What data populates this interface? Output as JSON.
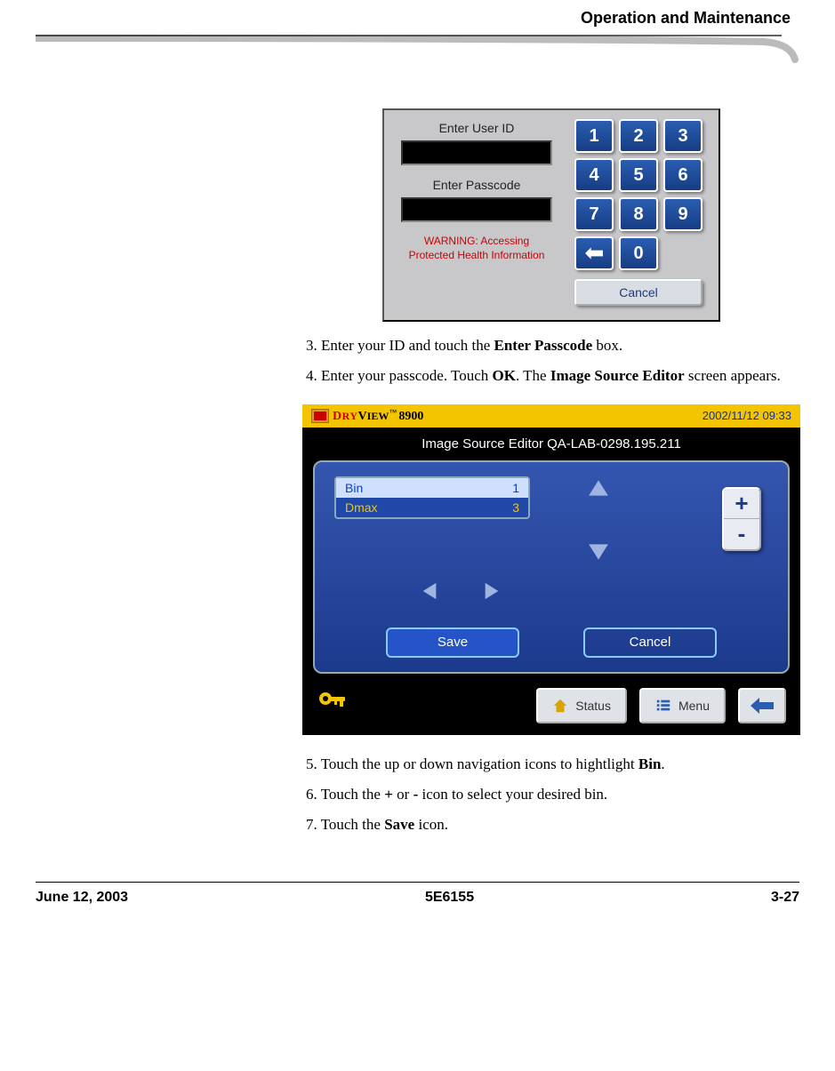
{
  "header": {
    "section_title": "Operation and Maintenance"
  },
  "screenshot1": {
    "label_user": "Enter User ID",
    "label_pass": "Enter Passcode",
    "warning_l1": "WARNING: Accessing",
    "warning_l2": "Protected Health Information",
    "keys": [
      "1",
      "2",
      "3",
      "4",
      "5",
      "6",
      "7",
      "8",
      "9"
    ],
    "zero": "0",
    "cancel": "Cancel"
  },
  "instructions_a": [
    {
      "n": "3.",
      "pre": "Enter your ID and touch the ",
      "b1": "Enter Passcode",
      "post": " box."
    },
    {
      "n": "4.",
      "pre": "Enter your passcode. Touch ",
      "b1": "OK",
      "mid": ". The ",
      "b2": "Image Source Editor",
      "post": " screen appears."
    }
  ],
  "screenshot2": {
    "brand_dry": "D",
    "brand_ry": "RY",
    "brand_v": "V",
    "brand_iew": "IEW",
    "brand_tm": "™",
    "brand_model": "8900",
    "timestamp": "2002/11/12 09:33",
    "title": "Image Source Editor QA-LAB-0298.195.211",
    "rows": [
      {
        "name": "Bin",
        "val": "1",
        "selected": true
      },
      {
        "name": "Dmax",
        "val": "3",
        "selected": false
      }
    ],
    "plus": "+",
    "minus": "-",
    "save": "Save",
    "cancel": "Cancel",
    "footer_status": "Status",
    "footer_menu": "Menu"
  },
  "instructions_b": [
    {
      "n": "5.",
      "pre": "Touch the up or down navigation icons to hightlight ",
      "b1": "Bin",
      "post": "."
    },
    {
      "n": "6.",
      "pre": "Touch the ",
      "b1": "+",
      "mid": " or ",
      "b2": "-",
      "post": " icon to select your desired bin."
    },
    {
      "n": "7.",
      "pre": "Touch the ",
      "b1": "Save",
      "post": " icon."
    }
  ],
  "footer": {
    "date": "June 12, 2003",
    "docnum": "5E6155",
    "page": "3-27"
  }
}
